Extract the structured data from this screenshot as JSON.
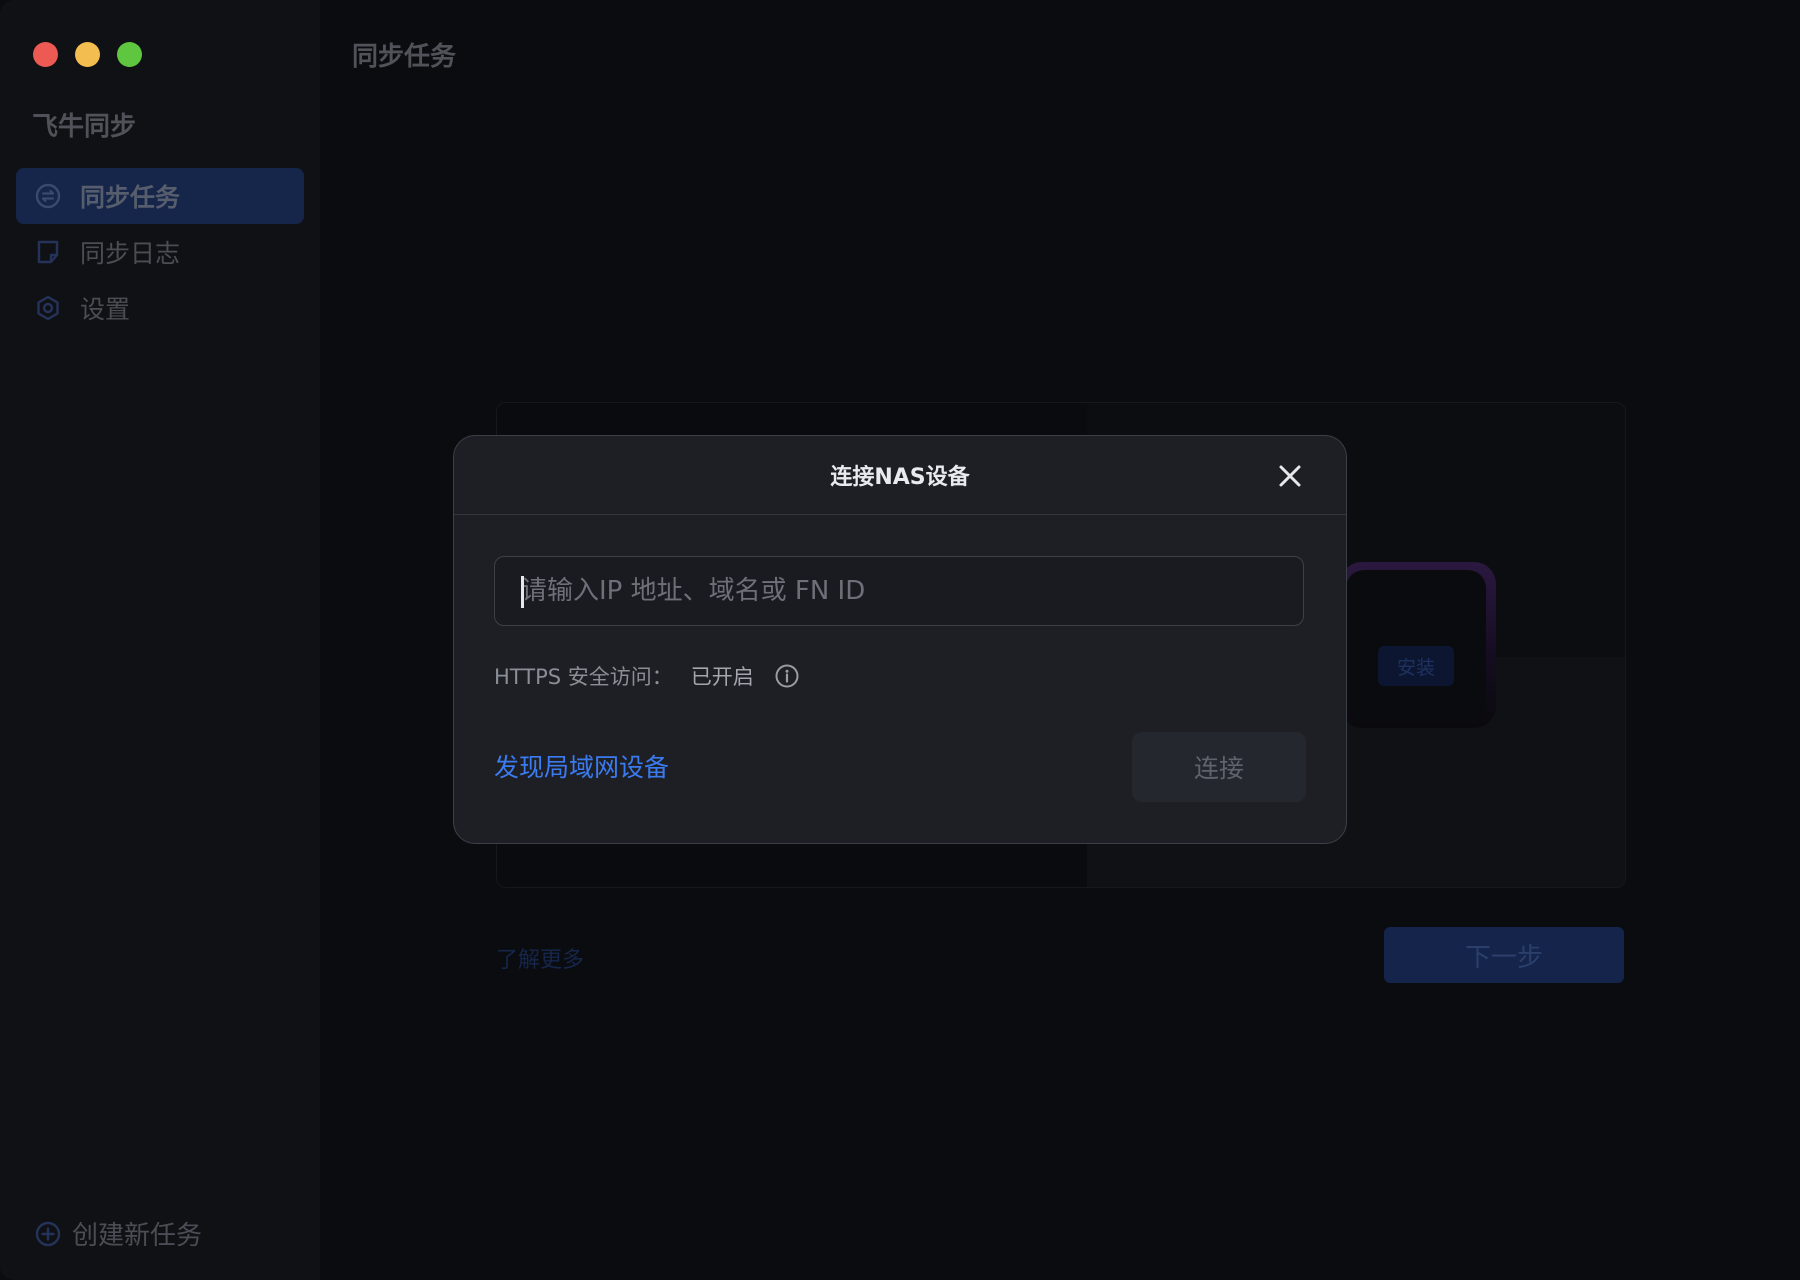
{
  "window": {
    "traffic_lights": {
      "close_color": "#ed5a53",
      "minimize_color": "#f4bd4f",
      "zoom_color": "#5fc73f"
    }
  },
  "sidebar": {
    "app_name": "飞牛同步",
    "items": [
      {
        "label": "同步任务",
        "icon": "sync-icon",
        "active": true
      },
      {
        "label": "同步日志",
        "icon": "log-icon",
        "active": false
      },
      {
        "label": "设置",
        "icon": "gear-icon",
        "active": false
      }
    ],
    "create_task_label": "创建新任务"
  },
  "main": {
    "title": "同步任务",
    "background_card": {
      "install_label": "安装"
    },
    "learn_more_label": "了解更多",
    "next_label": "下一步"
  },
  "modal": {
    "title": "连接NAS设备",
    "input": {
      "value": "",
      "placeholder": "请输入IP 地址、域名或 FN ID"
    },
    "https_label": "HTTPS 安全访问：",
    "https_status": "已开启",
    "discover_label": "发现局域网设备",
    "connect_label": "连接"
  },
  "colors": {
    "accent": "#3b7bf0",
    "sidebar_active_bg": "#16254a",
    "modal_bg": "#1d1f25"
  }
}
